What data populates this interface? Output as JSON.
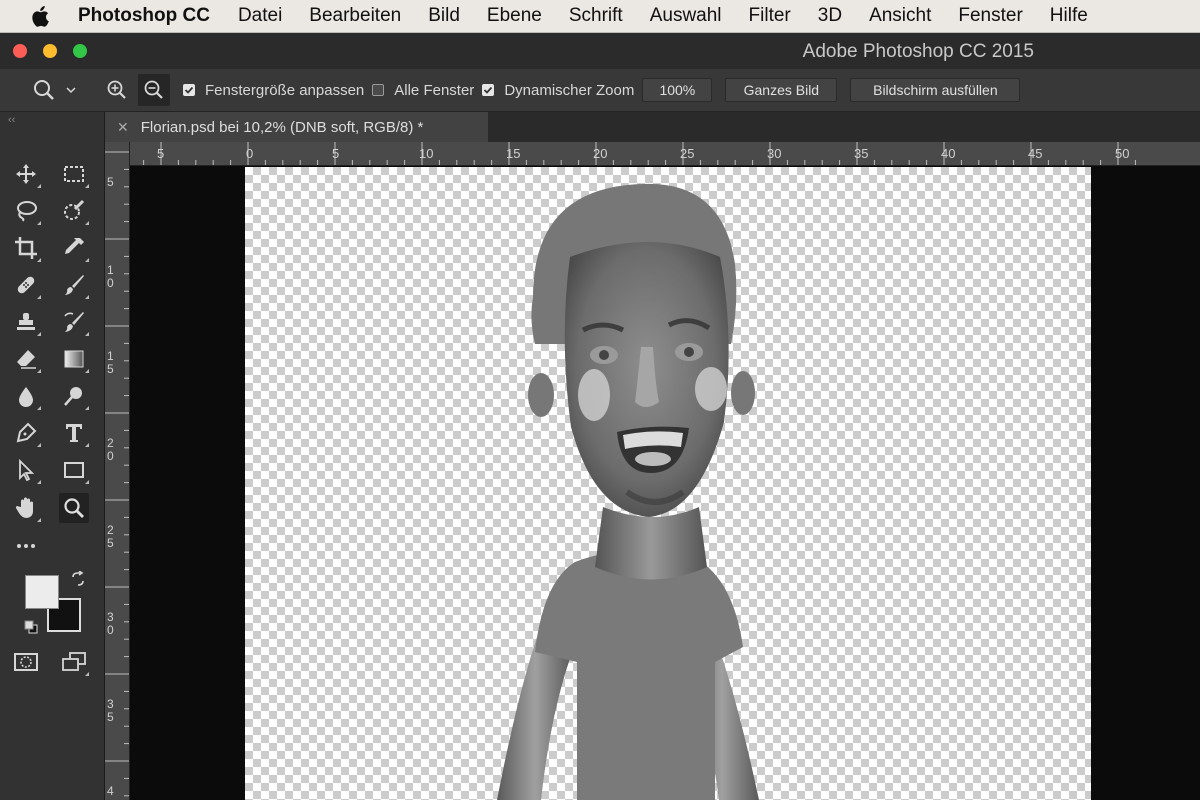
{
  "menubar": {
    "app_name": "Photoshop CC",
    "items": [
      "Datei",
      "Bearbeiten",
      "Bild",
      "Ebene",
      "Schrift",
      "Auswahl",
      "Filter",
      "3D",
      "Ansicht",
      "Fenster",
      "Hilfe"
    ]
  },
  "window": {
    "title": "Adobe Photoshop CC 2015"
  },
  "options": {
    "fit_window_label": "Fenstergröße anpassen",
    "fit_window_checked": true,
    "all_windows_label": "Alle Fenster",
    "all_windows_checked": false,
    "dynamic_zoom_label": "Dynamischer Zoom",
    "dynamic_zoom_checked": true,
    "zoom_value": "100%",
    "fit_screen_button": "Ganzes Bild",
    "fill_screen_button": "Bildschirm ausfüllen"
  },
  "document": {
    "tab_title": "Florian.psd bei 10,2% (DNB soft, RGB/8) *"
  },
  "rulers": {
    "horizontal": [
      "5",
      "0",
      "5",
      "10",
      "15",
      "20",
      "25",
      "30",
      "35",
      "40",
      "45",
      "50"
    ],
    "vertical": [
      "5",
      "10",
      "15",
      "20",
      "25",
      "30",
      "35",
      "4"
    ]
  },
  "colors": {
    "foreground": "#ececec",
    "background": "#111111",
    "accent": "#fc5e57"
  },
  "icons": {
    "tools": [
      "move-icon",
      "marquee-icon",
      "lasso-icon",
      "quick-select-icon",
      "crop-icon",
      "eyedropper-icon",
      "healing-icon",
      "brush-icon",
      "stamp-icon",
      "history-brush-icon",
      "eraser-icon",
      "gradient-icon",
      "blur-icon",
      "dodge-icon",
      "pen-icon",
      "type-icon",
      "path-select-icon",
      "rectangle-icon",
      "hand-icon",
      "zoom-icon",
      "more-icon"
    ]
  }
}
